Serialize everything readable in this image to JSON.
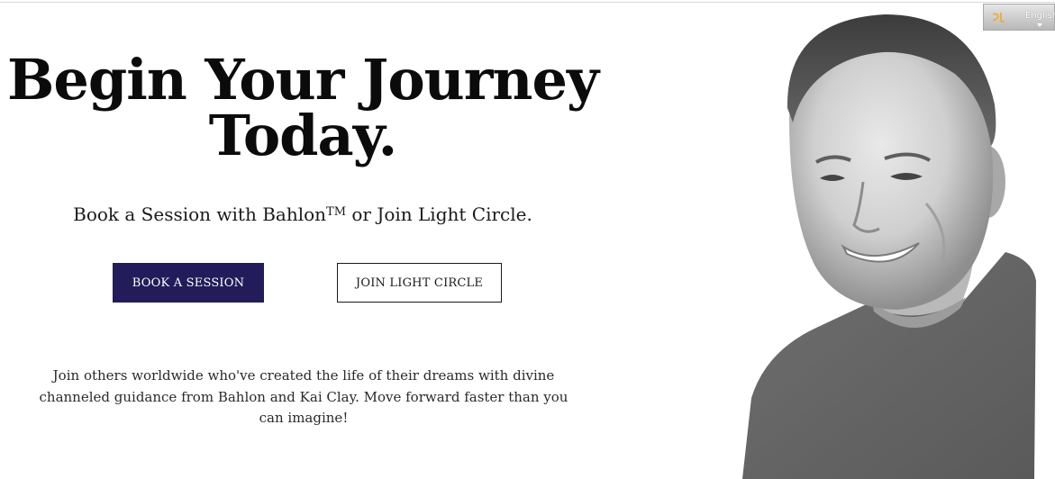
{
  "hero": {
    "headline_line1": "Begin Your Journey",
    "headline_line2": "Today.",
    "subhead_before": "Book a Session with Bahlon",
    "subhead_tm": "TM",
    "subhead_after": " or Join Light Circle.",
    "book_button_label": "BOOK A SESSION",
    "join_button_label": "JOIN LIGHT CIRCLE",
    "body_text": "Join others worldwide who've created the life of their dreams with divine channeled guidance from Bahlon and Kai Clay. Move forward faster than you can imagine!"
  },
  "portrait": {
    "alt": "Portrait photo"
  },
  "language_selector": {
    "label": "English",
    "icon": "translate-icon"
  },
  "colors": {
    "primary_button": "#221c5a",
    "text": "#0b0b0b",
    "background": "#ffffff"
  }
}
